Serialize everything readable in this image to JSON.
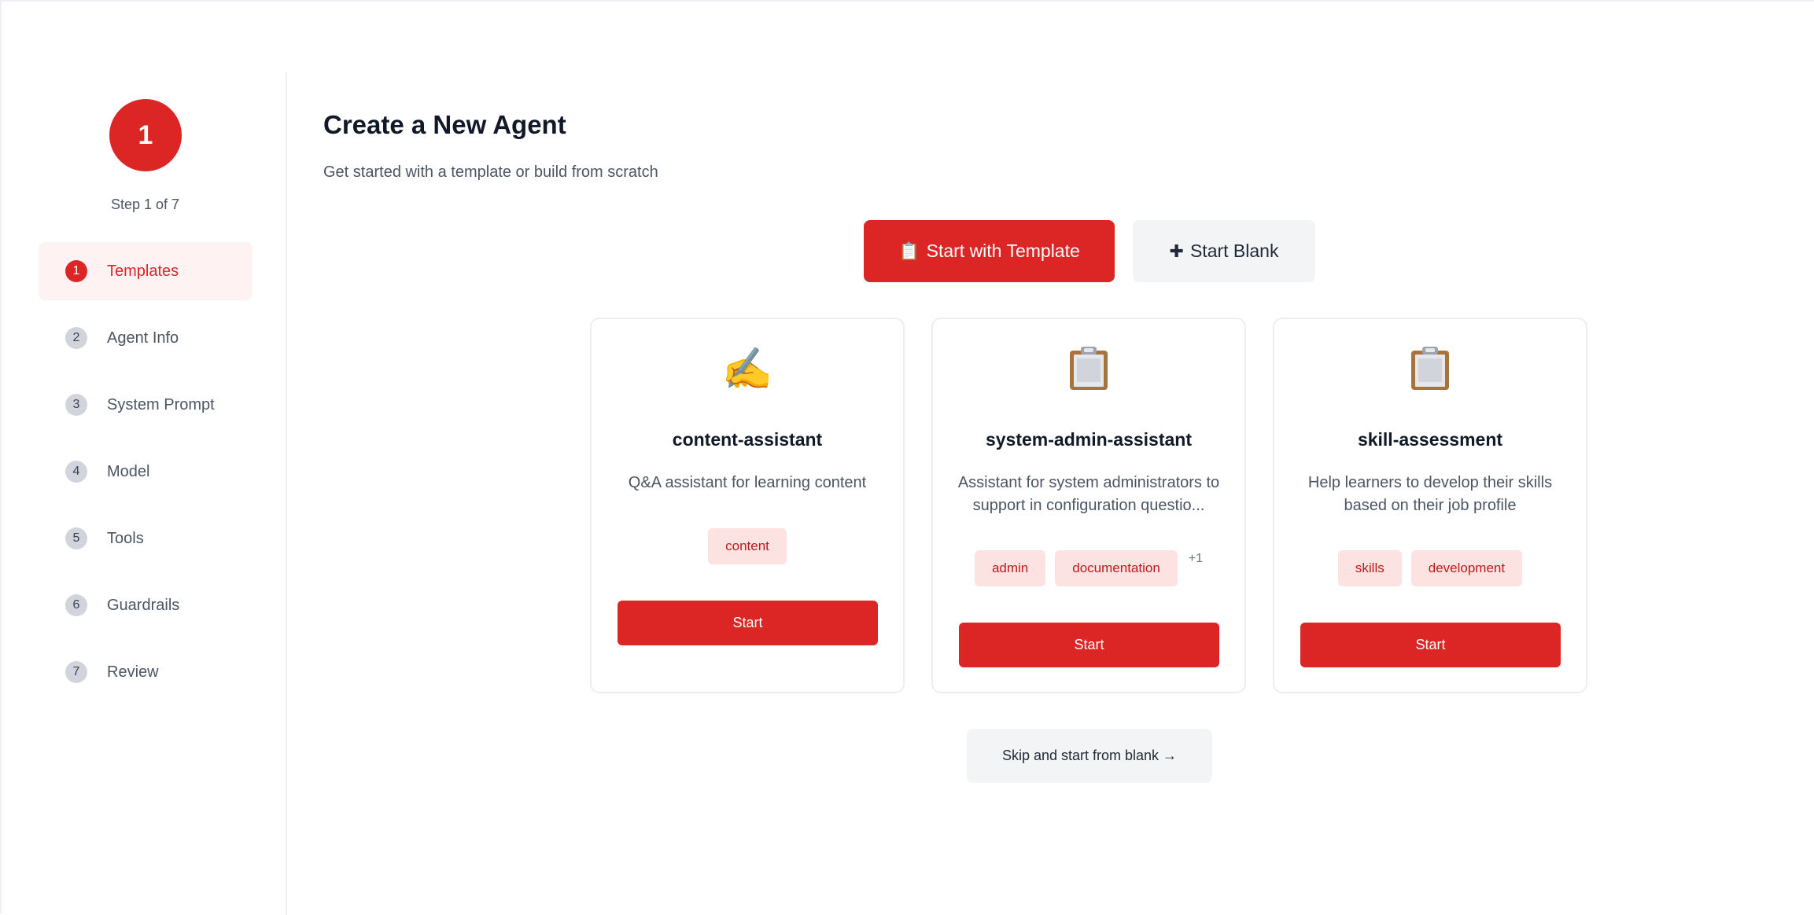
{
  "sidebar": {
    "current_step_number": "1",
    "step_caption": "Step 1 of 7",
    "items": [
      {
        "number": "1",
        "label": "Templates"
      },
      {
        "number": "2",
        "label": "Agent Info"
      },
      {
        "number": "3",
        "label": "System Prompt"
      },
      {
        "number": "4",
        "label": "Model"
      },
      {
        "number": "5",
        "label": "Tools"
      },
      {
        "number": "6",
        "label": "Guardrails"
      },
      {
        "number": "7",
        "label": "Review"
      }
    ]
  },
  "main": {
    "title": "Create a New Agent",
    "subtitle": "Get started with a template or build from scratch",
    "mode_buttons": {
      "template_icon": "📋",
      "template_label": "Start with Template",
      "blank_icon": "✚",
      "blank_label": "Start Blank"
    },
    "templates": [
      {
        "icon": "writing-hand-icon",
        "icon_glyph": "✍️",
        "name": "content-assistant",
        "description": "Q&A assistant for learning content",
        "tags": [
          "content"
        ],
        "extra_tags": "",
        "start_label": "Start"
      },
      {
        "icon": "clipboard-icon",
        "icon_glyph": "📋",
        "name": "system-admin-assistant",
        "description": "Assistant for system administrators to support in configuration questio...",
        "tags": [
          "admin",
          "documentation"
        ],
        "extra_tags": "+1",
        "start_label": "Start"
      },
      {
        "icon": "clipboard-icon",
        "icon_glyph": "📋",
        "name": "skill-assessment",
        "description": "Help learners to develop their skills based on their job profile",
        "tags": [
          "skills",
          "development"
        ],
        "extra_tags": "",
        "start_label": "Start"
      }
    ],
    "skip_label": "Skip and start from blank →"
  },
  "colors": {
    "accent": "#dc2626",
    "accent_soft": "#fef2f2",
    "tag_bg": "#fde2e2",
    "tag_text": "#b91c1c"
  }
}
